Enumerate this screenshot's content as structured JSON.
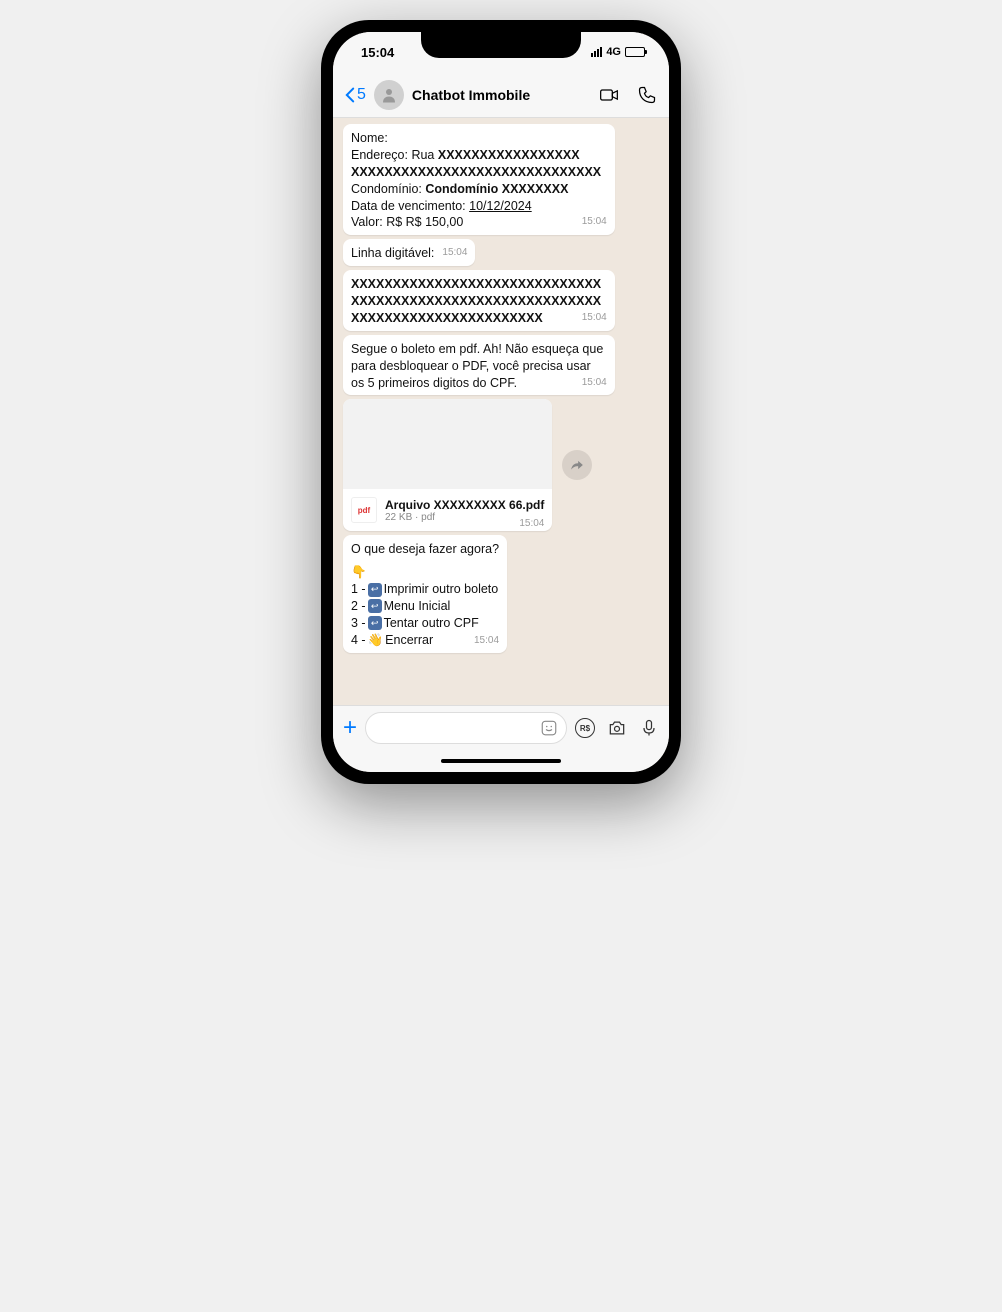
{
  "statusBar": {
    "time": "15:04",
    "network": "4G"
  },
  "header": {
    "backCount": "5",
    "title": "Chatbot Immobile"
  },
  "messages": {
    "m1": {
      "nome_label": "Nome:",
      "endereco_label": "Endereço: Rua ",
      "endereco_value": "XXXXXXXXXXXXXXXXX XXXXXXXXXXXXXXXXXXXXXXXXXXXXXX",
      "condominio_label": "Condomínio: ",
      "condominio_value": "Condomínio   XXXXXXXX",
      "data_venc_label": "Data de vencimento: ",
      "data_venc_value": "10/12/2024",
      "valor_label": "Valor: R$ R$ 150,00",
      "time": "15:04"
    },
    "m2": {
      "text": "Linha digitável:",
      "time": "15:04"
    },
    "m3": {
      "text": "XXXXXXXXXXXXXXXXXXXXXXXXXXXXXX XXXXXXXXXXXXXXXXXXXXXXXXXXXXXX XXXXXXXXXXXXXXXXXXXXXXX",
      "time": "15:04"
    },
    "m4": {
      "text": "Segue o boleto em pdf. Ah! Não esqueça que para desbloquear o PDF, você precisa usar os 5 primeiros digitos do CPF.",
      "time": "15:04"
    },
    "attachment": {
      "badge": "pdf",
      "filename": "Arquivo    XXXXXXXXX 66.pdf",
      "meta": "22 KB · pdf",
      "time": "15:04"
    },
    "m5": {
      "prompt": "O que deseja fazer agora?",
      "pointer": "👇",
      "opt1_prefix": "1 - ",
      "opt1_label": "Imprimir outro boleto",
      "opt2_prefix": "2 - ",
      "opt2_label": "Menu Inicial",
      "opt3_prefix": "3 - ",
      "opt3_label": "Tentar outro CPF",
      "opt4_prefix": "4 - ",
      "opt4_emoji": "👋",
      "opt4_label": "Encerrar",
      "time": "15:04"
    }
  },
  "inputBar": {
    "rs": "R$"
  }
}
